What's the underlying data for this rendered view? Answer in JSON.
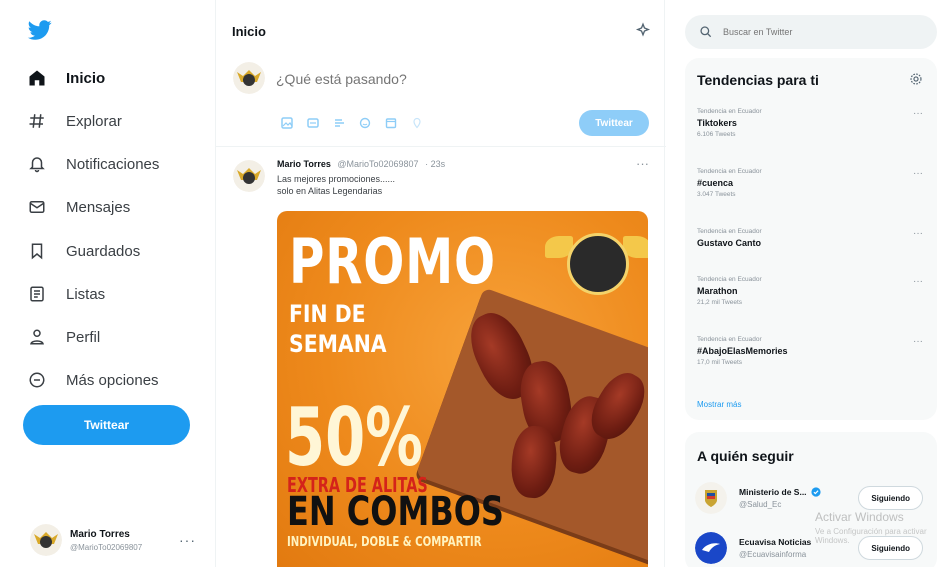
{
  "sidebar": {
    "nav": [
      {
        "label": "Inicio",
        "icon": "home-icon",
        "active": true
      },
      {
        "label": "Explorar",
        "icon": "hashtag-icon"
      },
      {
        "label": "Notificaciones",
        "icon": "bell-icon"
      },
      {
        "label": "Mensajes",
        "icon": "mail-icon"
      },
      {
        "label": "Guardados",
        "icon": "bookmark-icon"
      },
      {
        "label": "Listas",
        "icon": "list-icon"
      },
      {
        "label": "Perfil",
        "icon": "person-icon"
      },
      {
        "label": "Más opciones",
        "icon": "more-circle-icon"
      }
    ],
    "tweet_button": "Twittear",
    "account": {
      "name": "Mario Torres",
      "handle": "@MarioTo02069807"
    }
  },
  "main": {
    "title": "Inicio",
    "composer": {
      "placeholder": "¿Qué está pasando?",
      "post_button": "Twittear"
    },
    "tweet": {
      "author": "Mario Torres",
      "handle": "@MarioTo02069807",
      "time": "· 23s",
      "line1": "Las mejores promociones......",
      "line2": "solo en Alitas Legendarias",
      "promo": {
        "line1": "PROMO",
        "line2": "FIN DE",
        "line3": "SEMANA",
        "line4": "50%",
        "line5": "EXTRA DE ALITAS",
        "line6": "EN COMBOS",
        "line7": "INDIVIDUAL, DOBLE & COMPARTIR"
      }
    }
  },
  "right": {
    "search_placeholder": "Buscar en Twitter",
    "trends_title": "Tendencias para ti",
    "trends": [
      {
        "context": "Tendencia en Ecuador",
        "name": "Tiktokers",
        "count": "6.106 Tweets"
      },
      {
        "context": "Tendencia en Ecuador",
        "name": "#cuenca",
        "count": "3.047 Tweets"
      },
      {
        "context": "Tendencia en Ecuador",
        "name": "Gustavo Canto",
        "count": ""
      },
      {
        "context": "Tendencia en Ecuador",
        "name": "Marathon",
        "count": "21,2 mil Tweets"
      },
      {
        "context": "Tendencia en Ecuador",
        "name": "#AbajoElasMemories",
        "count": "17,0 mil Tweets"
      }
    ],
    "show_more": "Mostrar más",
    "follow_title": "A quién seguir",
    "follow": [
      {
        "name": "Ministerio de S...",
        "handle": "@Salud_Ec",
        "verified": true,
        "button": "Siguiendo"
      },
      {
        "name": "Ecuavisa Noticias",
        "handle": "@Ecuavisainforma",
        "verified": false,
        "button": "Siguiendo"
      }
    ]
  },
  "watermark": {
    "line1": "Activar Windows",
    "line2": "Ve a Configuración para activar Windows."
  },
  "colors": {
    "accent": "#1d9bf0",
    "promo_orange": "#ee8a1c"
  }
}
